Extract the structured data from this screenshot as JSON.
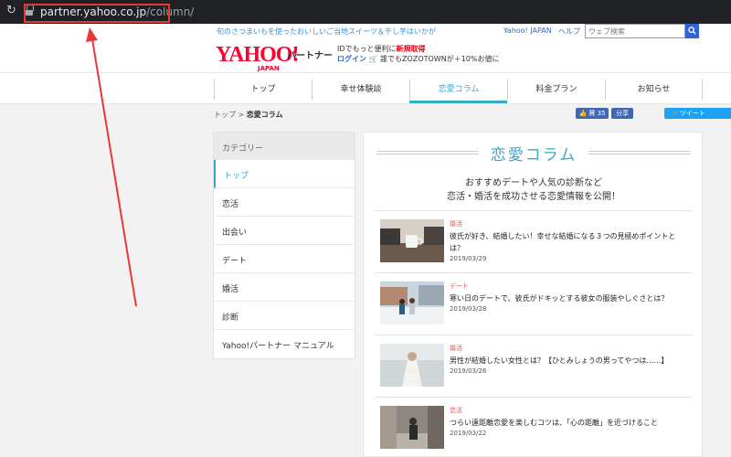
{
  "browser": {
    "reload_icon": "reload-icon",
    "url_domain": "partner.yahoo.co.jp",
    "url_path": "/column/"
  },
  "header": {
    "tagline": "旬のさつまいもを使ったおいしいご当地スイーツ＆干し芋はいかが",
    "yahoo_japan_link": "Yahoo! JAPAN",
    "help_link": "ヘルプ",
    "search_placeholder": "ウェブ検索",
    "logo_main": "YAHOO!",
    "logo_sub": "JAPAN",
    "logo_partner": "パートナー",
    "id_text": "IDでもっと便利に",
    "id_register": "新規取得",
    "login": "ログイン",
    "zozo_text": "誰でもZOZOTOWNが＋10%お値に"
  },
  "nav": {
    "items": [
      "トップ",
      "幸せ体験談",
      "恋愛コラム",
      "料金プラン",
      "お知らせ"
    ],
    "active_index": 2
  },
  "breadcrumb": {
    "home": "トップ",
    "separator": ">",
    "current": "恋愛コラム"
  },
  "social": {
    "like": "👍 賛 35",
    "share": "分享",
    "tweet": "ツイート"
  },
  "sidebar": {
    "heading": "カテゴリー",
    "items": [
      "トップ",
      "恋活",
      "出会い",
      "デート",
      "婚活",
      "診断",
      "Yahoo!パートナー マニュアル"
    ]
  },
  "main": {
    "title": "恋愛コラム",
    "intro_line1": "おすすめデートや人気の診断など",
    "intro_line2": "恋活・婚活を成功させる恋愛情報を公開！",
    "articles": [
      {
        "category": "婚活",
        "title": "彼氏が好き、結婚したい！幸せな結婚になる３つの見極めポイントとは？",
        "date": "2019/03/29"
      },
      {
        "category": "デート",
        "title": "寒い日のデートで、彼氏がドキッとする彼女の服装やしぐさとは？",
        "date": "2019/03/28"
      },
      {
        "category": "婚活",
        "title": "男性が結婚したい女性とは？【ひとみしょうの男ってやつは……】",
        "date": "2019/03/26"
      },
      {
        "category": "恋活",
        "title": "つらい遠距離恋愛を楽しむコツは、「心の距離」を近づけること",
        "date": "2019/03/22"
      }
    ]
  },
  "colors": {
    "accent": "#3aa7c8",
    "yahoo_red": "#ff0033",
    "annotation_red": "#e53935",
    "category_red": "#e5544f"
  }
}
